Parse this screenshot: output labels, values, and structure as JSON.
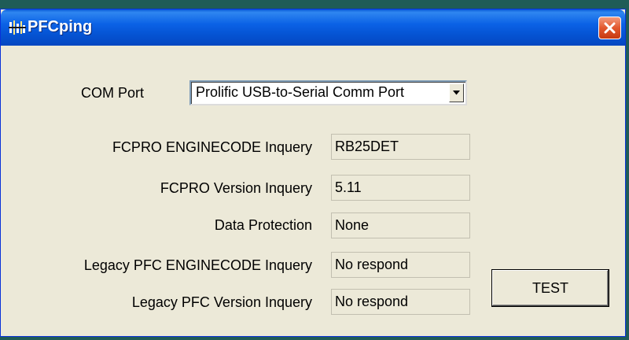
{
  "window": {
    "title": "PFCping",
    "icon": "pfc-app-icon",
    "close_icon": "close-icon"
  },
  "com_port": {
    "label": "COM Port",
    "selected": "Prolific USB-to-Serial Comm Port",
    "arrow_icon": "chevron-down-icon"
  },
  "rows": [
    {
      "label": "FCPRO ENGINECODE Inquery",
      "value": "RB25DET"
    },
    {
      "label": "FCPRO Version Inquery",
      "value": "5.11"
    },
    {
      "label": "Data Protection",
      "value": "None"
    },
    {
      "label": "Legacy PFC ENGINECODE Inquery",
      "value": "No respond"
    },
    {
      "label": "Legacy PFC Version Inquery",
      "value": "No respond"
    }
  ],
  "buttons": {
    "test_label": "TEST"
  },
  "colors": {
    "titlebar": "#0553d3",
    "window_bg": "#ece9d8",
    "desktop": "#1f5c57",
    "close": "#e2582e"
  }
}
